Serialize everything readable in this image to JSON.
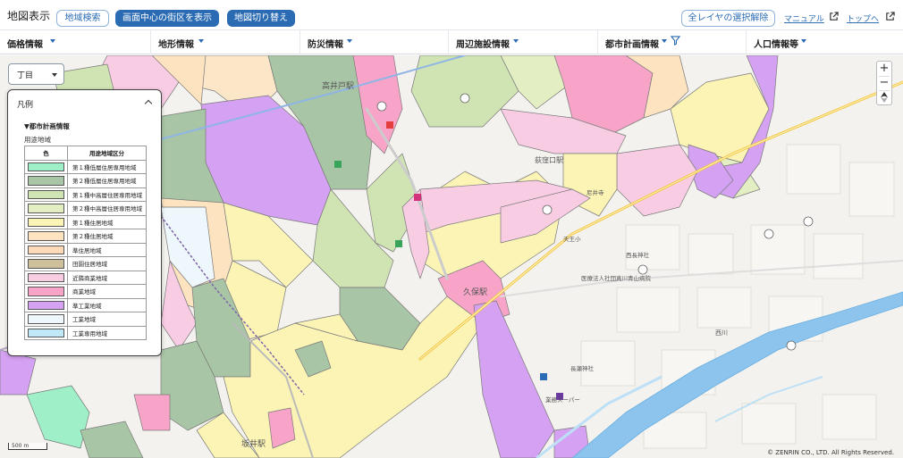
{
  "header": {
    "title": "地図表示",
    "buttons": {
      "area_search": "地域検索",
      "show_center_block": "画面中心の街区を表示",
      "map_switch": "地図切り替え",
      "clear_layers": "全レイヤの選択解除"
    },
    "links": {
      "manual": "マニュアル",
      "top": "トップへ"
    }
  },
  "categories": [
    "価格情報",
    "地形情報",
    "防災情報",
    "周辺施設情報",
    "都市計画情報",
    "人口情報等"
  ],
  "map": {
    "chome_select": "丁目",
    "zoom_in": "+",
    "zoom_out": "−",
    "scale": "500 m",
    "copyright": "© ZENRIN CO., LTD. All Rights Reserved.",
    "labels": {
      "station1": "高井戸駅",
      "station2": "荻窪口駅",
      "station3": "久保駅",
      "station4": "坂井駅",
      "river": "西川",
      "hospital": "医療法人社団真川青山病院",
      "shrine1": "長瀬神社",
      "shrine2": "西長神社",
      "school": "天王小",
      "temple": "尼井寺",
      "label_shop": "業務スーパー"
    }
  },
  "legend": {
    "title": "凡例",
    "section": "▼都市計画情報",
    "subtitle": "用途地域",
    "columns": [
      "色",
      "用途地域区分"
    ],
    "rows": [
      {
        "color": "#9ff0c9",
        "name": "第１種低層住居専用地域"
      },
      {
        "color": "#a8c5a5",
        "name": "第２種低層住居専用地域"
      },
      {
        "color": "#cfe3b3",
        "name": "第１種中高層住居専用地域"
      },
      {
        "color": "#e3efc3",
        "name": "第２種中高層住居専用地域"
      },
      {
        "color": "#fbf4b5",
        "name": "第１種住居地域"
      },
      {
        "color": "#fde3bf",
        "name": "第２種住居地域"
      },
      {
        "color": "#fdd9b8",
        "name": "準住居地域"
      },
      {
        "color": "#cfc09c",
        "name": "田園住居地域"
      },
      {
        "color": "#f8cde4",
        "name": "近隣商業地域"
      },
      {
        "color": "#f7a4c8",
        "name": "商業地域"
      },
      {
        "color": "#d5a1f2",
        "name": "準工業地域"
      },
      {
        "color": "#eef7fb",
        "name": "工業地域"
      },
      {
        "color": "#bfe9f7",
        "name": "工業専用地域"
      }
    ]
  }
}
